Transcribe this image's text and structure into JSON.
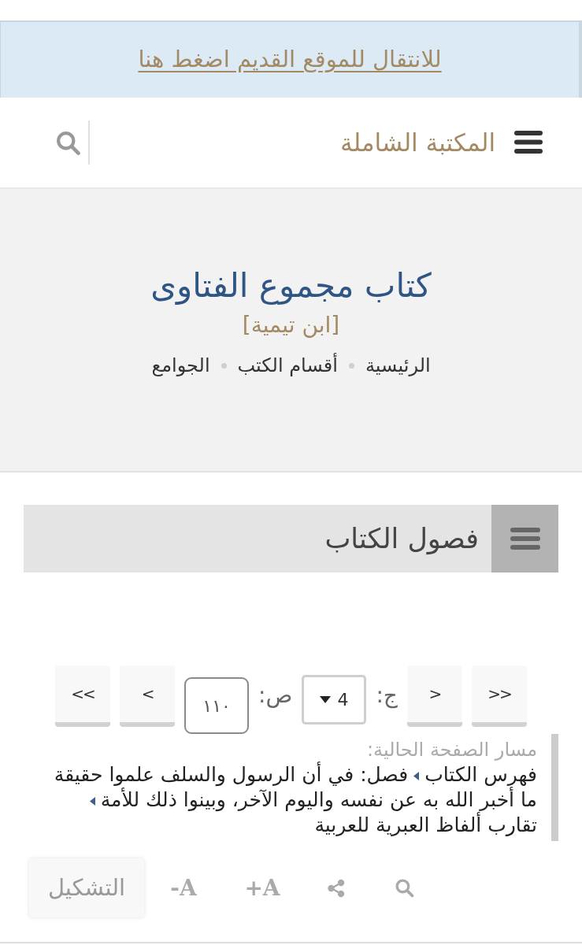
{
  "notice": {
    "link": "للانتقال للموقع القديم اضغط هنا"
  },
  "navbar": {
    "brand": "المكتبة الشاملة"
  },
  "header": {
    "title": "كتاب مجموع الفتاوى",
    "author": "[ابن تيمية]",
    "breadcrumb": [
      "الرئيسية",
      "أقسام الكتب",
      "الجوامع"
    ]
  },
  "chapters_panel": {
    "title": "فصول الكتاب"
  },
  "pager": [
    {
      "kind": "button",
      "label": ">>"
    },
    {
      "kind": "button",
      "label": ">"
    },
    {
      "kind": "label",
      "text": "ج:"
    },
    {
      "kind": "select",
      "value": "4"
    },
    {
      "kind": "label",
      "text": "ص:"
    },
    {
      "kind": "input",
      "value": "١١٠"
    },
    {
      "kind": "button",
      "label": "<"
    },
    {
      "kind": "button",
      "label": "<<"
    }
  ],
  "current_path": {
    "heading": "مسار الصفحة الحالية:",
    "items": [
      "فهرس الكتاب",
      "فصل: في أن الرسول والسلف علموا حقيقة ما أخبر الله به عن نفسه واليوم الآخر، وبينوا ذلك للأمة",
      "تقارب ألفاظ العبرية للعربية"
    ]
  },
  "toolbar": [
    {
      "kind": "search"
    },
    {
      "kind": "share"
    },
    {
      "kind": "text",
      "label": "+A"
    },
    {
      "kind": "text",
      "label": "-A"
    },
    {
      "kind": "button",
      "label": "التشكيل"
    }
  ]
}
